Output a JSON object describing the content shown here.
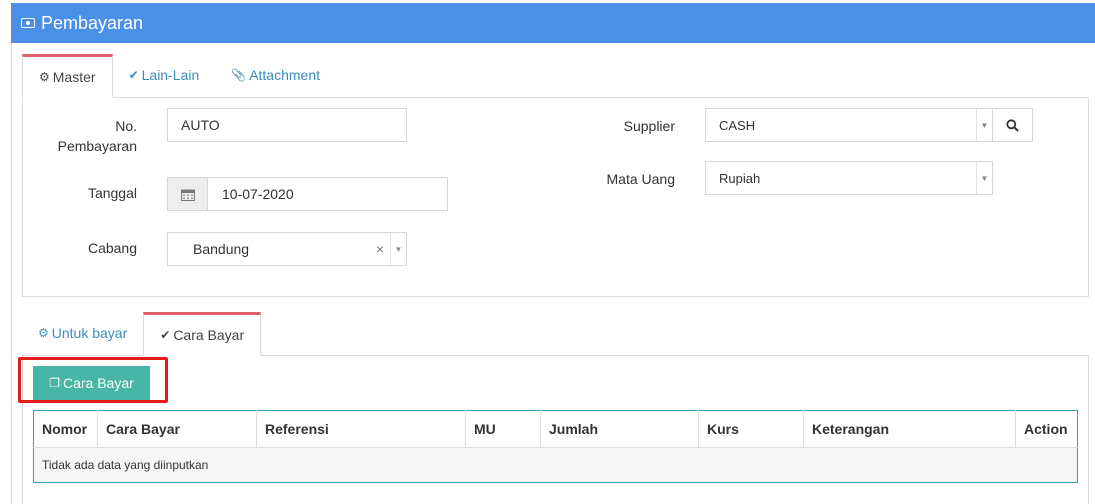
{
  "header": {
    "title": "Pembayaran",
    "icon": "money-icon"
  },
  "top_tabs": [
    {
      "label": "Master",
      "icon": "cogs-icon",
      "active": true
    },
    {
      "label": "Lain-Lain",
      "icon": "check-circle-icon",
      "active": false
    },
    {
      "label": "Attachment",
      "icon": "paperclip-icon",
      "active": false
    }
  ],
  "form": {
    "no_label_line1": "No.",
    "no_label_line2": "Pembayaran",
    "no_value": "AUTO",
    "tanggal_label": "Tanggal",
    "tanggal_value": "10-07-2020",
    "cabang_label": "Cabang",
    "cabang_value": "Bandung",
    "cabang_clear": "×",
    "supplier_label": "Supplier",
    "supplier_value": "CASH",
    "mata_uang_label": "Mata Uang",
    "mata_uang_value": "Rupiah"
  },
  "bottom_tabs": [
    {
      "label": "Untuk bayar",
      "icon": "cogs-icon",
      "active": false
    },
    {
      "label": "Cara Bayar",
      "icon": "check-circle-icon",
      "active": true
    }
  ],
  "add_button": {
    "label": "Cara Bayar",
    "icon": "copy-icon"
  },
  "table": {
    "columns": [
      "Nomor",
      "Cara Bayar",
      "Referensi",
      "MU",
      "Jumlah",
      "Kurs",
      "Keterangan",
      "Action"
    ],
    "empty_message": "Tidak ada data yang diinputkan"
  },
  "colors": {
    "header": "#4a8fe8",
    "active_tab_accent": "#e35d6a",
    "add_button": "#48b6a6",
    "highlight": "#e21b1b",
    "link": "#3c8dbc"
  }
}
